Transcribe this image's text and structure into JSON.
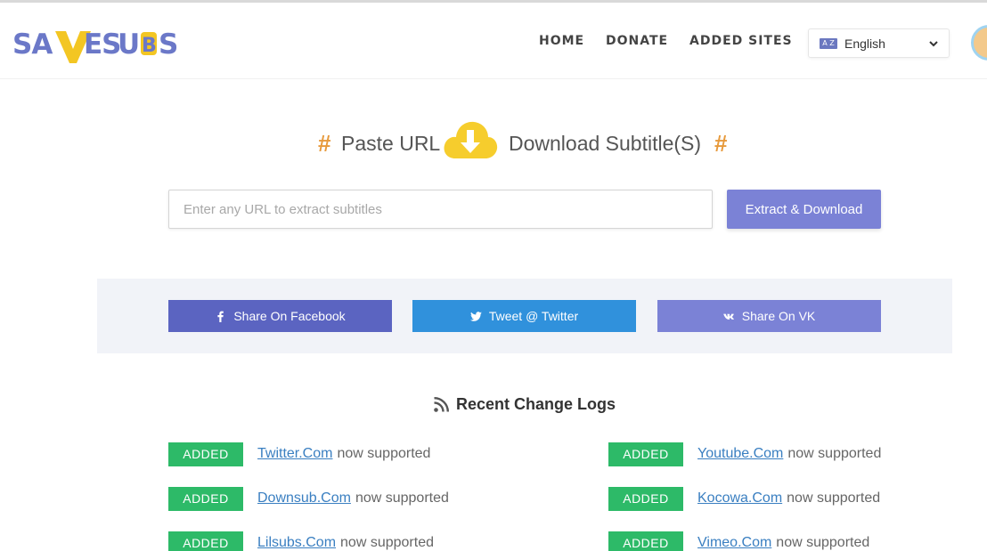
{
  "header": {
    "logo_text": "SAVESUBS",
    "nav": [
      {
        "label": "HOME"
      },
      {
        "label": "DONATE"
      },
      {
        "label": "ADDED SITES"
      }
    ],
    "language": {
      "flag_text": "A Z",
      "selected": "English"
    }
  },
  "hero": {
    "hash": "#",
    "left_text": "Paste URL",
    "right_text": "Download Subtitle(S)",
    "cloud_icon": "cloud-download-icon"
  },
  "search": {
    "placeholder": "Enter any URL to extract subtitles",
    "value": "",
    "button_label": "Extract & Download"
  },
  "share": [
    {
      "label": "Share On Facebook",
      "icon": "facebook-icon",
      "color": "#5b64c1"
    },
    {
      "label": "Tweet @ Twitter",
      "icon": "twitter-icon",
      "color": "#3091dc"
    },
    {
      "label": "Share On VK",
      "icon": "vk-icon",
      "color": "#7b82d6"
    }
  ],
  "changelog": {
    "title": "Recent Change Logs",
    "suffix": "now supported",
    "badge": "ADDED",
    "left": [
      {
        "site": "Twitter.Com"
      },
      {
        "site": "Downsub.Com"
      },
      {
        "site": "Lilsubs.Com"
      }
    ],
    "right": [
      {
        "site": "Youtube.Com"
      },
      {
        "site": "Kocowa.Com"
      },
      {
        "site": "Vimeo.Com"
      }
    ]
  },
  "colors": {
    "accent": "#7b82d6",
    "hash": "#e79a3c",
    "badge": "#2dba68",
    "link": "#3a7fc1"
  }
}
